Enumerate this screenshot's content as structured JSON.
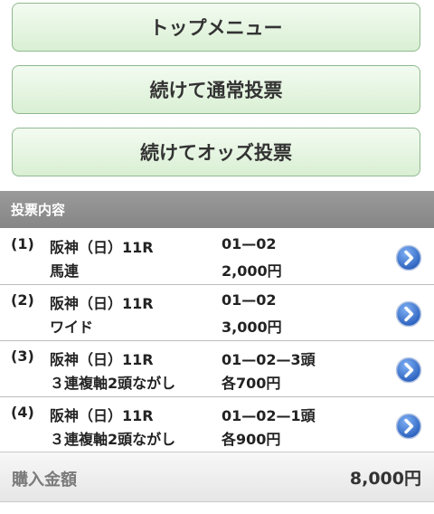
{
  "buttons": {
    "top_menu": "トップメニュー",
    "continue_normal": "続けて通常投票",
    "continue_odds": "続けてオッズ投票"
  },
  "section": {
    "title": "投票内容"
  },
  "bets": [
    {
      "num": "(1)",
      "race": "阪神（日）11R",
      "type": "馬連",
      "combo": "01—02",
      "amount": "2,000円"
    },
    {
      "num": "(2)",
      "race": "阪神（日）11R",
      "type": "ワイド",
      "combo": "01—02",
      "amount": "3,000円"
    },
    {
      "num": "(3)",
      "race": "阪神（日）11R",
      "type": "３連複軸2頭ながし",
      "combo": "01—02—3頭",
      "amount": "各700円"
    },
    {
      "num": "(4)",
      "race": "阪神（日）11R",
      "type": "３連複軸2頭ながし",
      "combo": "01—02—1頭",
      "amount": "各900円"
    }
  ],
  "total": {
    "label": "購入金額",
    "value": "8,000円"
  },
  "colors": {
    "button_bg": "#d9efd3",
    "arrow_blue": "#2f6fd0",
    "header_gray": "#8c8c8c"
  },
  "icons": {
    "row_arrow": "chevron-right-circle-icon"
  }
}
